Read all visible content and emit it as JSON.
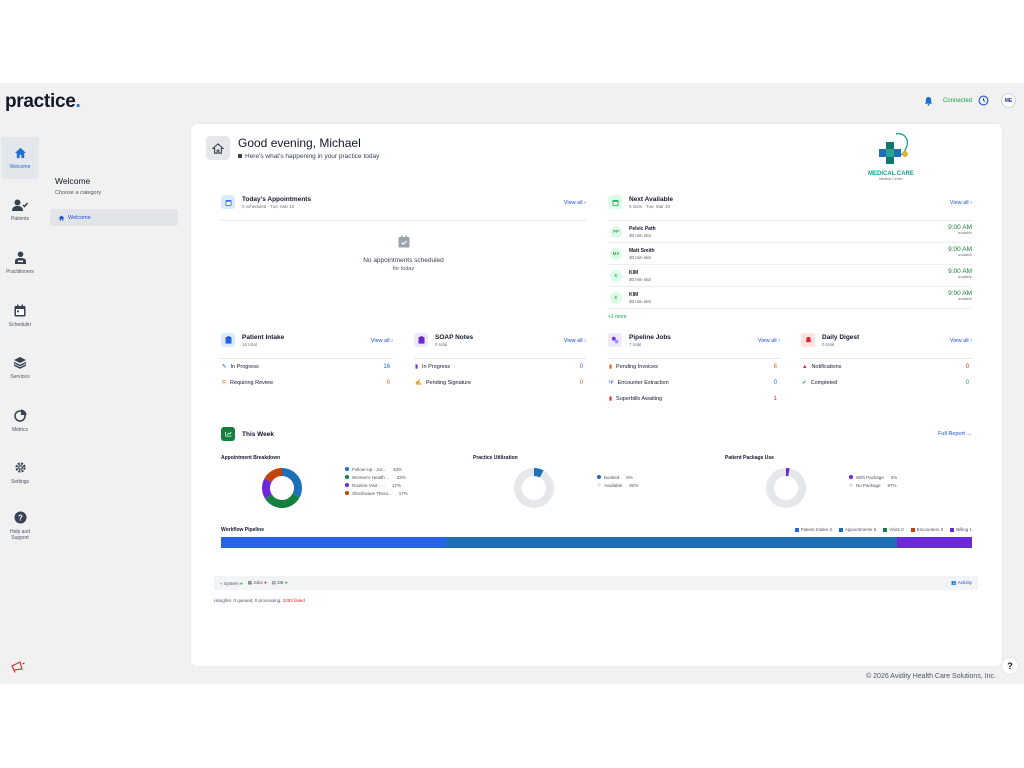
{
  "app": {
    "logo": "practice",
    "logo_dot": ".",
    "connection_status": "Connected",
    "user_initials": "ME"
  },
  "rail": [
    {
      "label": "Welcome",
      "icon": "home-icon",
      "active": true
    },
    {
      "label": "Patients",
      "icon": "users-icon"
    },
    {
      "label": "Practitioners",
      "icon": "practitioner-icon"
    },
    {
      "label": "Scheduler",
      "icon": "calendar-icon"
    },
    {
      "label": "Services",
      "icon": "layers-icon"
    },
    {
      "label": "Metrics",
      "icon": "pie-chart-icon"
    },
    {
      "label": "Settings",
      "icon": "gear-icon"
    },
    {
      "label": "Help and Support",
      "icon": "question-icon"
    }
  ],
  "subnav": {
    "title": "Welcome",
    "subtitle": "Choose a category",
    "items": [
      {
        "label": "Welcome"
      }
    ]
  },
  "greeting": {
    "title": "Good evening, Michael",
    "subtitle": "Here's what's happening in your practice today"
  },
  "brand": {
    "name": "MEDICAL CARE",
    "tagline": "Medical Center"
  },
  "appointments": {
    "title": "Today's Appointments",
    "subtitle": "0 scheduled · Tue, Mar 10",
    "view_all": "View all ›",
    "empty_title": "No appointments scheduled",
    "empty_sub": "for today"
  },
  "next_available": {
    "title": "Next Available",
    "subtitle": "5 slots · Tue, Mar 10",
    "view_all": "View all ›",
    "slots": [
      {
        "initials": "PP",
        "name": "Pelvic Path",
        "duration": "30 min slot",
        "time": "9:00 AM",
        "status": "available"
      },
      {
        "initials": "MS",
        "name": "Matt Smith",
        "duration": "30 min slot",
        "time": "9:00 AM",
        "status": "available"
      },
      {
        "initials": "K",
        "name": "KIM",
        "duration": "30 min slot",
        "time": "9:00 AM",
        "status": "available"
      },
      {
        "initials": "K",
        "name": "KIM",
        "duration": "30 min slot",
        "time": "9:00 AM",
        "status": "available"
      }
    ],
    "more": "+1 more"
  },
  "patient_intake": {
    "title": "Patient Intake",
    "subtitle": "16 total",
    "view_all": "View all ›",
    "rows": [
      {
        "label": "In Progress",
        "value": "16"
      },
      {
        "label": "Requiring Review",
        "value": "0"
      }
    ]
  },
  "soap_notes": {
    "title": "SOAP Notes",
    "subtitle": "0 total",
    "view_all": "View all ›",
    "rows": [
      {
        "label": "In Progress",
        "value": "0"
      },
      {
        "label": "Pending Signature",
        "value": "0"
      }
    ]
  },
  "pipeline_jobs": {
    "title": "Pipeline Jobs",
    "subtitle": "7 total",
    "view_all": "View all ›",
    "rows": [
      {
        "label": "Pending Invoices",
        "value": "6"
      },
      {
        "label": "Encounter Extraction",
        "value": "0"
      },
      {
        "label": "Superbills Awaiting",
        "value": "1"
      }
    ]
  },
  "daily_digest": {
    "title": "Daily Digest",
    "subtitle": "0 total",
    "view_all": "View all ›",
    "rows": [
      {
        "label": "Notifications",
        "value": "0"
      },
      {
        "label": "Completed",
        "value": "0"
      }
    ]
  },
  "this_week": {
    "title": "This Week",
    "full_report": "Full Report →",
    "appointment_breakdown": {
      "title": "Appointment Breakdown",
      "legend": [
        {
          "label": "Follow-Up - Jor...",
          "pct": "33%",
          "color": "#1d6fb8"
        },
        {
          "label": "Women's Health ...",
          "pct": "33%",
          "color": "#15803d"
        },
        {
          "label": "Routine Visit - ...",
          "pct": "17%",
          "color": "#6d28d9"
        },
        {
          "label": "Shockwave Thera...",
          "pct": "17%",
          "color": "#c2410c"
        }
      ]
    },
    "practice_utilization": {
      "title": "Practice Utilization",
      "legend": [
        {
          "label": "Booked",
          "pct": "8%",
          "color": "#1d6fb8"
        },
        {
          "label": "Available",
          "pct": "92%",
          "color": "#e5e7eb"
        }
      ]
    },
    "package_use": {
      "title": "Patient Package Use",
      "legend": [
        {
          "label": "With Package",
          "pct": "3%",
          "color": "#6d28d9"
        },
        {
          "label": "No Package",
          "pct": "97%",
          "color": "#e5e7eb"
        }
      ]
    },
    "workflow": {
      "title": "Workflow Pipeline",
      "legend": [
        {
          "label": "Patient Intake",
          "value": "3",
          "color": "#2563eb"
        },
        {
          "label": "Appointments",
          "value": "6",
          "color": "#1d6fb8"
        },
        {
          "label": "Visits",
          "value": "0",
          "color": "#15803d"
        },
        {
          "label": "Encounters",
          "value": "0",
          "color": "#c2410c"
        },
        {
          "label": "Billing",
          "value": "1",
          "color": "#6d28d9"
        }
      ]
    }
  },
  "chart_data": [
    {
      "type": "pie",
      "title": "Appointment Breakdown",
      "categories": [
        "Follow-Up - Jor...",
        "Women's Health ...",
        "Routine Visit - ...",
        "Shockwave Thera..."
      ],
      "values": [
        33,
        33,
        17,
        17
      ]
    },
    {
      "type": "pie",
      "title": "Practice Utilization",
      "categories": [
        "Booked",
        "Available"
      ],
      "values": [
        8,
        92
      ]
    },
    {
      "type": "pie",
      "title": "Patient Package Use",
      "categories": [
        "With Package",
        "No Package"
      ],
      "values": [
        3,
        97
      ]
    },
    {
      "type": "bar",
      "title": "Workflow Pipeline",
      "categories": [
        "Patient Intake",
        "Appointments",
        "Visits",
        "Encounters",
        "Billing"
      ],
      "values": [
        3,
        6,
        0,
        0,
        1
      ]
    }
  ],
  "status_bar": {
    "system": "System",
    "jobs": "Jobs",
    "db": "DB",
    "activity": "Activity",
    "heartbeat_prefix": "Hangfire: 0 queued, 0 processing, ",
    "heartbeat_failed": "2253 failed"
  },
  "footer": {
    "copyright": "© 2026 Avidity Health Care Solutions, Inc.",
    "help": "?"
  }
}
